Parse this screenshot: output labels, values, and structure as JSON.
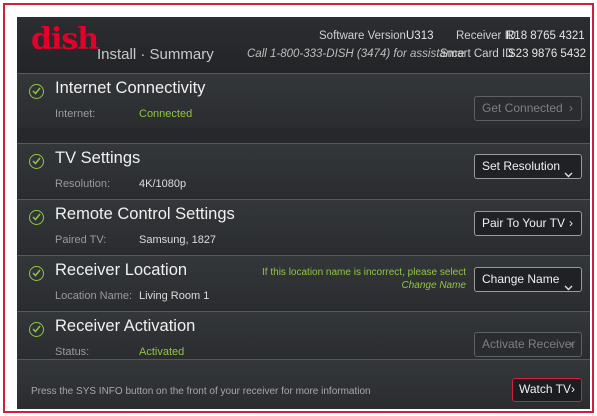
{
  "header": {
    "logo": "dish",
    "subtitle": "Install · Summary",
    "software_version_label": "Software Version",
    "software_version": "U313",
    "receiver_id_label": "Receiver ID",
    "receiver_id": "R18 8765 4321",
    "assistance": "Call 1-800-333-DISH (3474) for assistance",
    "smart_card_label": "Smart Card ID",
    "smart_card_id": "S23 9876 5432"
  },
  "rows": [
    {
      "title": "Internet Connectivity",
      "label": "Internet:",
      "value": "Connected",
      "button": "Get Connected",
      "chevron": "›"
    },
    {
      "title": "TV Settings",
      "label": "Resolution:",
      "value": "4K/1080p",
      "button": "Set Resolution"
    },
    {
      "title": "Remote Control Settings",
      "label": "Paired TV:",
      "value": "Samsung, 1827",
      "button": "Pair To Your TV",
      "chevron": "›"
    },
    {
      "title": "Receiver Location",
      "label": "Location Name:",
      "value": "Living Room 1",
      "button": "Change Name",
      "note": "If this location name is incorrect, please select",
      "note_link": "Change Name"
    },
    {
      "title": "Receiver Activation",
      "label": "Status:",
      "value": "Activated",
      "button": "Activate Receiver",
      "chevron": "›"
    }
  ],
  "footer": {
    "info": "Press the SYS INFO button on the front of your receiver for more information",
    "watch_button": "Watch TV",
    "chevron": "›"
  },
  "colors": {
    "brand_red": "#e4002b",
    "accent_green": "#8fc641",
    "frame_red": "#d21f3c"
  },
  "icons": [
    "check-circle-icon",
    "chevron-right-icon",
    "chevron-down-icon"
  ]
}
